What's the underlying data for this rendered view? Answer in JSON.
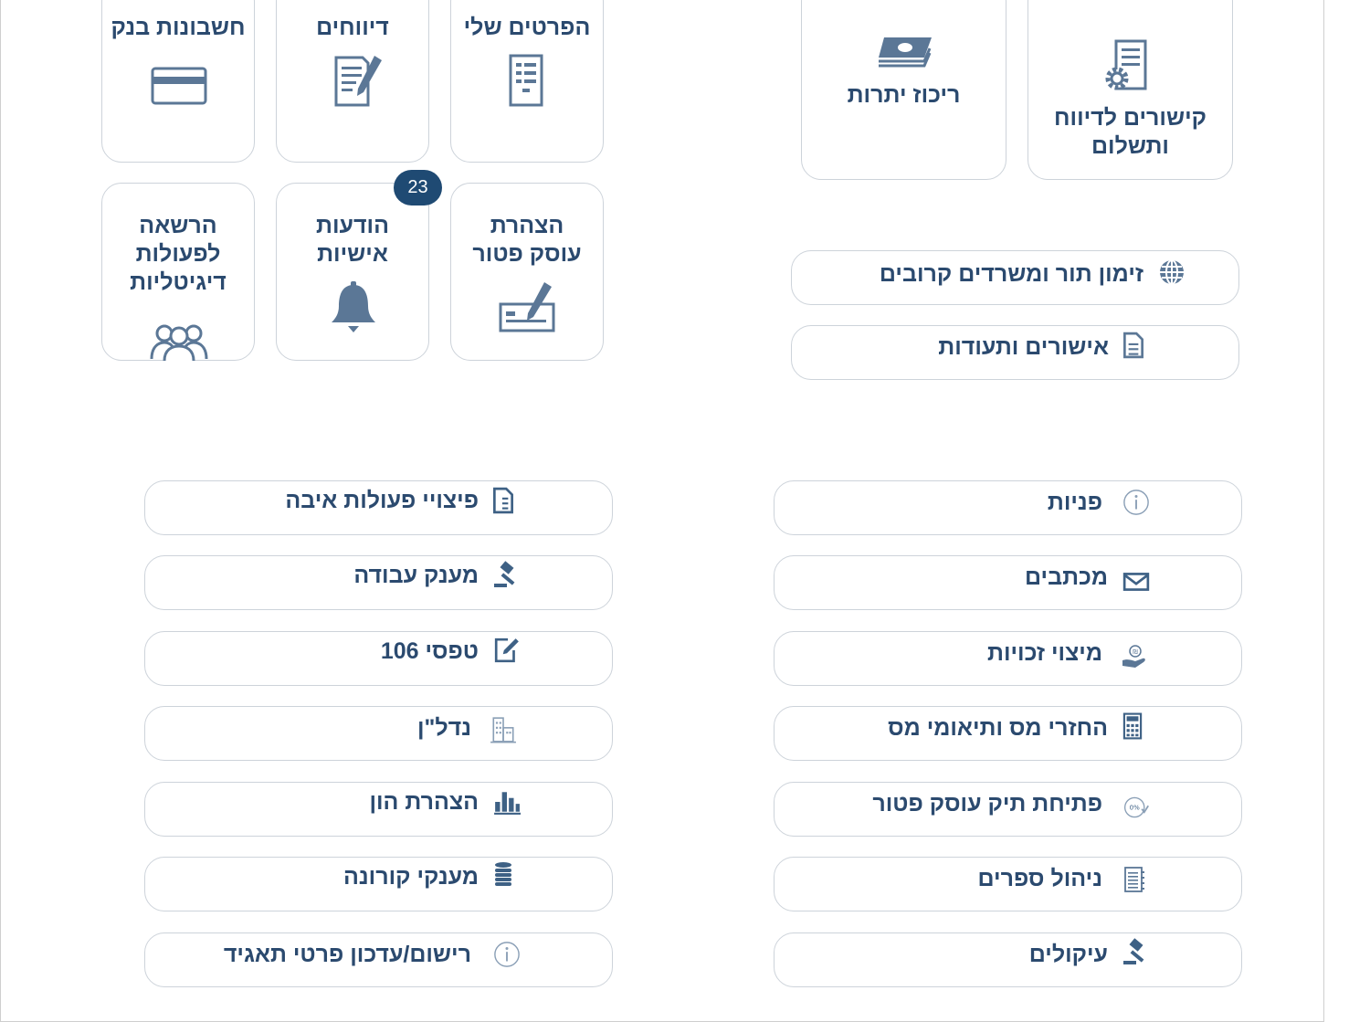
{
  "tiles_left": [
    {
      "label": "הפרטים שלי",
      "icon": "document-list-icon"
    },
    {
      "label": "דיווחים",
      "icon": "document-edit-icon"
    },
    {
      "label": "חשבונות בנק",
      "icon": "credit-card-icon"
    },
    {
      "label": "הצהרת עוסק פטור",
      "icon": "check-sign-icon"
    },
    {
      "label": "הודעות אישיות",
      "icon": "bell-icon",
      "badge": "23"
    },
    {
      "label": "הרשאה לפעולות דיגיטליות",
      "icon": "users-icon"
    }
  ],
  "tiles_right": [
    {
      "label": "קישורים לדיווח ותשלום",
      "icon": "document-gear-icon"
    },
    {
      "label": "ריכוז יתרות",
      "icon": "money-stack-icon"
    }
  ],
  "links_top": [
    {
      "label": "זימון תור ומשרדים קרובים",
      "icon": "globe-icon"
    },
    {
      "label": "אישורים ותעודות",
      "icon": "document-icon"
    }
  ],
  "links_right": [
    {
      "label": "פניות",
      "icon": "info-icon"
    },
    {
      "label": "מכתבים",
      "icon": "envelope-icon"
    },
    {
      "label": "מיצוי זכויות",
      "icon": "hand-coin-icon"
    },
    {
      "label": "החזרי מס ותיאומי מס",
      "icon": "calculator-icon"
    },
    {
      "label": "פתיחת תיק עוסק פטור",
      "icon": "percent-badge-icon"
    },
    {
      "label": "ניהול ספרים",
      "icon": "notebook-icon"
    },
    {
      "label": "עיקולים",
      "icon": "gavel-icon"
    }
  ],
  "links_left": [
    {
      "label": "פיצויי פעולות איבה",
      "icon": "document-icon"
    },
    {
      "label": "מענק עבודה",
      "icon": "gavel-icon"
    },
    {
      "label": "טפסי 106",
      "icon": "form-edit-icon"
    },
    {
      "label": "נדל\"ן",
      "icon": "building-icon"
    },
    {
      "label": "הצהרת הון",
      "icon": "bar-chart-icon"
    },
    {
      "label": "מענקי קורונה",
      "icon": "coins-stack-icon"
    },
    {
      "label": "רישום/עדכון פרטי תאגיד",
      "icon": "info-icon"
    }
  ],
  "colors": {
    "text": "#2b4a6f",
    "icon": "#5b7796",
    "border": "#cdd3da",
    "badge": "#1f4a73"
  }
}
